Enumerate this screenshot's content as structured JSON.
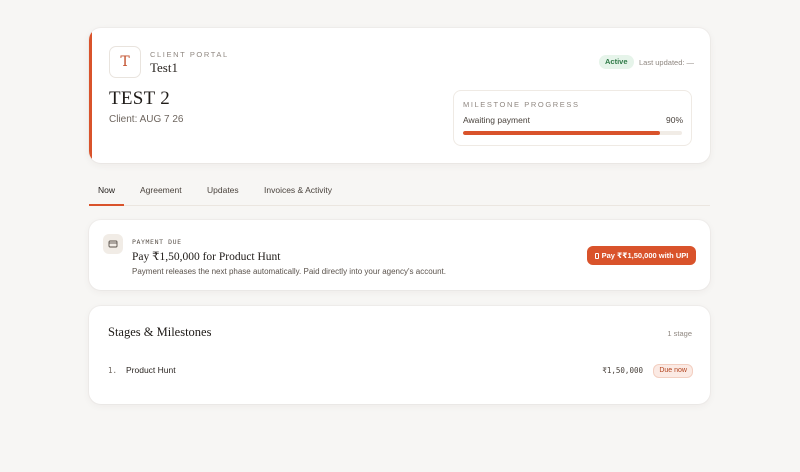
{
  "header": {
    "logo_letter": "T",
    "portal_label": "CLIENT PORTAL",
    "portal_name": "Test1",
    "status": "Active",
    "last_updated": "Last updated: —",
    "project_title": "TEST 2",
    "client_line": "Client: AUG 7 26",
    "milestone": {
      "label": "MILESTONE PROGRESS",
      "status": "Awaiting payment",
      "percent_text": "90%",
      "progress_percent": 90
    }
  },
  "tabs": [
    {
      "label": "Now",
      "active": true
    },
    {
      "label": "Agreement",
      "active": false
    },
    {
      "label": "Updates",
      "active": false
    },
    {
      "label": "Invoices & Activity",
      "active": false
    }
  ],
  "payment": {
    "due_label": "PAYMENT DUE",
    "title": "Pay ₹1,50,000 for Product Hunt",
    "description": "Payment releases the next phase automatically. Paid directly into your agency's account.",
    "button_label": "Pay ₹₹1,50,000 with UPI",
    "icon": "card-icon"
  },
  "stages": {
    "title": "Stages & Milestones",
    "count": "1 stage",
    "items": [
      {
        "num": "1.",
        "name": "Product Hunt",
        "amount": "₹1,50,000",
        "status": "Due now"
      }
    ]
  },
  "colors": {
    "accent": "#d9532b",
    "active_badge_bg": "#e6f4ea",
    "active_badge_text": "#2f7a47",
    "background": "#f7f6f4"
  }
}
